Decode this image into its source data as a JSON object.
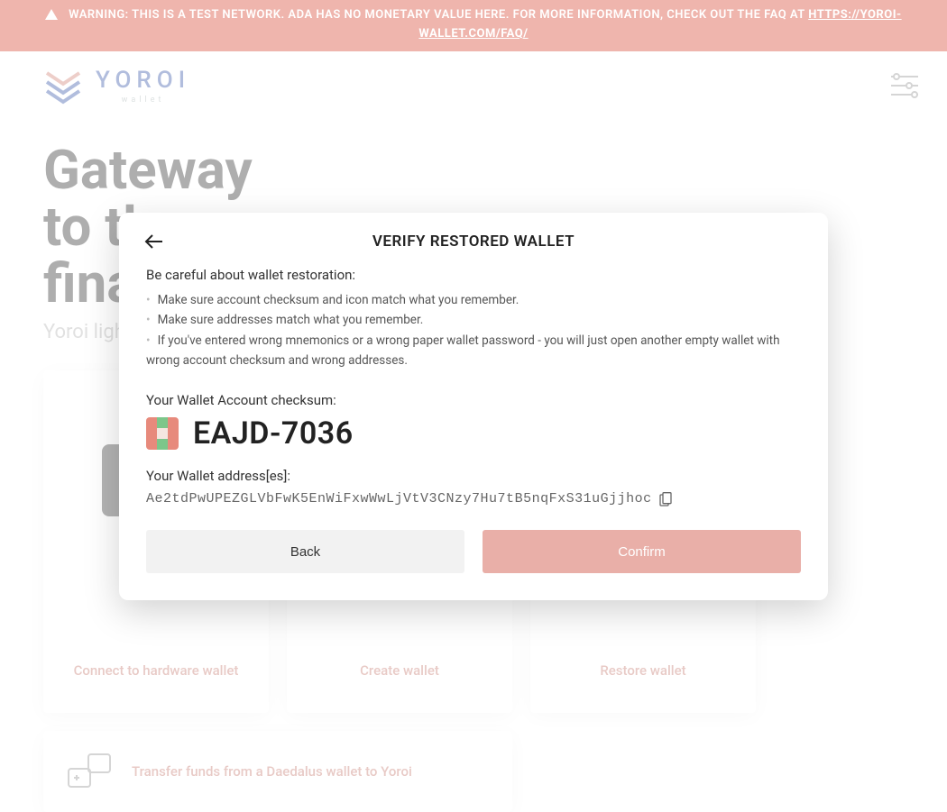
{
  "banner": {
    "text_prefix": "WARNING: THIS IS A TEST NETWORK. ADA HAS NO MONETARY VALUE HERE. FOR MORE INFORMATION, CHECK OUT THE FAQ AT ",
    "faq_url_label": "HTTPS://YOROI-WALLET.COM/FAQ/"
  },
  "brand": {
    "name": "YOROI",
    "sub": "wallet"
  },
  "hero": {
    "line1": "Gateway",
    "line2": "to the",
    "line3": "financial world",
    "subtitle": "Yoroi light wallet for Cardano"
  },
  "cards": {
    "hardware": "Connect to hardware wallet",
    "create": "Create wallet",
    "restore": "Restore wallet",
    "transfer": "Transfer funds from a Daedalus wallet to Yoroi"
  },
  "modal": {
    "title": "VERIFY RESTORED WALLET",
    "warn_title": "Be careful about wallet restoration:",
    "bullets": {
      "b1": "Make sure account checksum and icon match what you remember.",
      "b2": "Make sure addresses match what you remember.",
      "b3": "If you've entered wrong mnemonics or a wrong paper wallet password - you will just open another empty wallet with wrong account checksum and wrong addresses."
    },
    "checksum_label": "Your Wallet Account checksum:",
    "checksum": "EAJD-7036",
    "address_label": "Your Wallet address[es]:",
    "address": "Ae2tdPwUPEZGLVbFwK5EnWiFxwWwLjVtV3CNzy7Hu7tB5nqFxS31uGjjhoc",
    "back": "Back",
    "confirm": "Confirm"
  },
  "colors": {
    "accent": "#e9afa8",
    "banner_bg": "#efb5ad"
  }
}
